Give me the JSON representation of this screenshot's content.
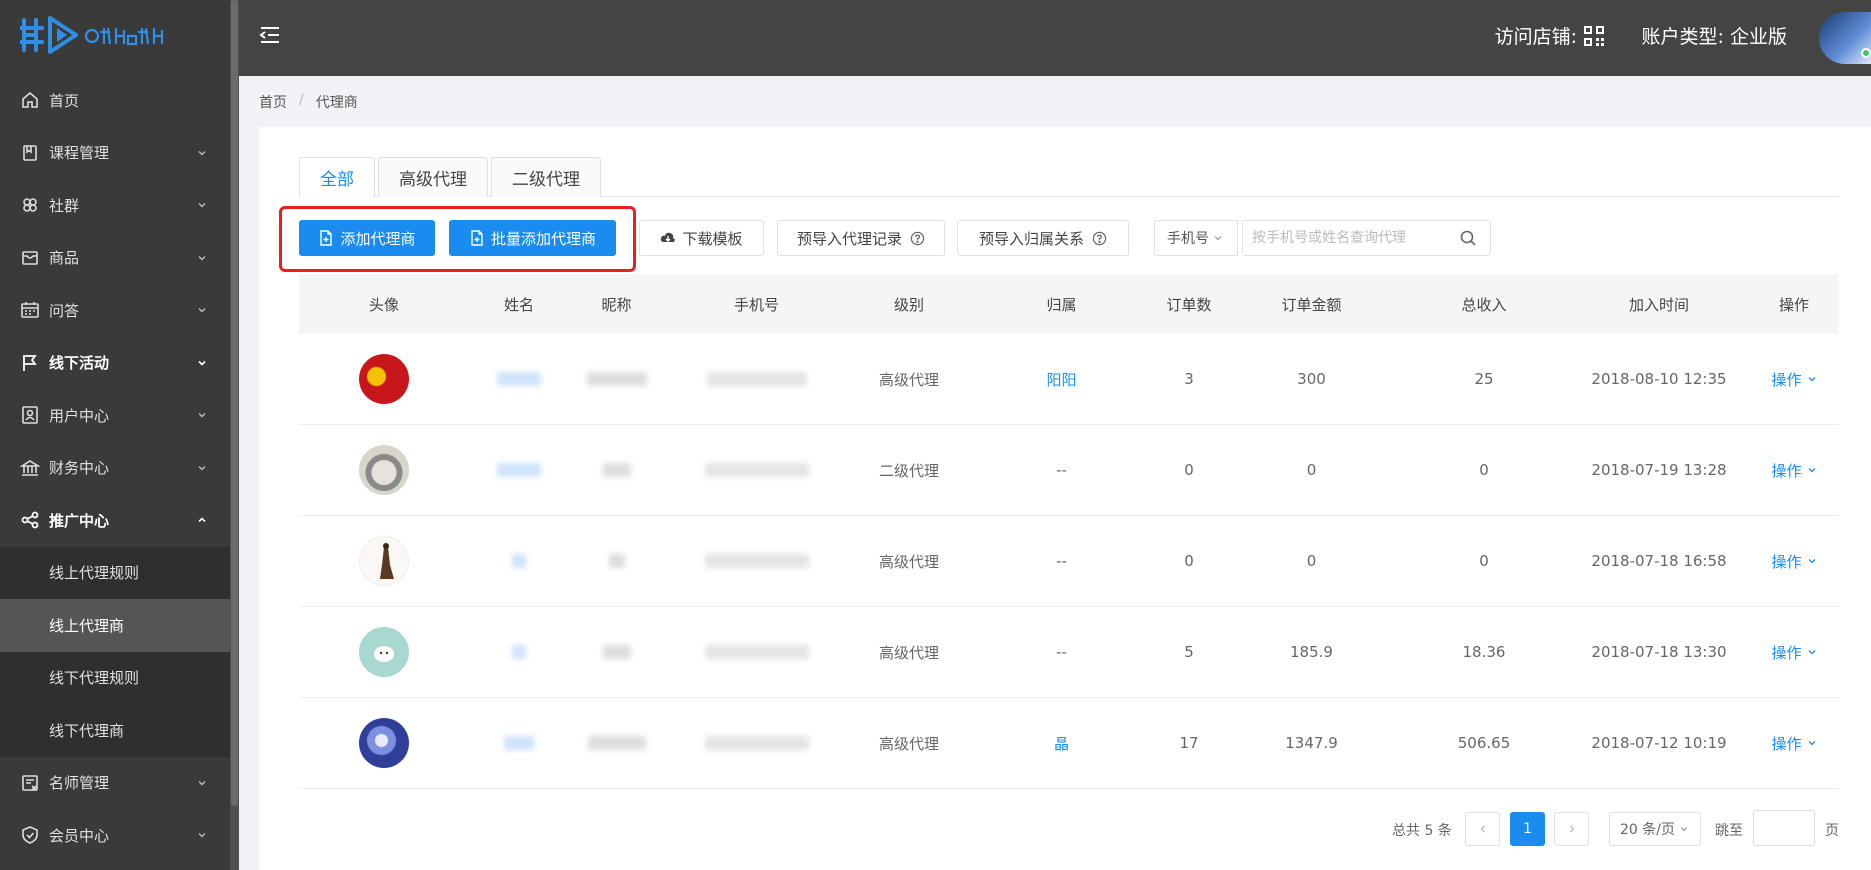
{
  "sidebar": {
    "items": [
      {
        "label": "首页",
        "icon": "home-icon"
      },
      {
        "label": "课程管理",
        "icon": "book-icon"
      },
      {
        "label": "社群",
        "icon": "group-icon"
      },
      {
        "label": "商品",
        "icon": "box-icon"
      },
      {
        "label": "问答",
        "icon": "calendar-icon"
      },
      {
        "label": "线下活动",
        "icon": "flag-icon"
      },
      {
        "label": "用户中心",
        "icon": "user-card-icon"
      },
      {
        "label": "财务中心",
        "icon": "bank-icon"
      },
      {
        "label": "推广中心",
        "icon": "share-icon"
      }
    ],
    "submenu": [
      {
        "label": "线上代理规则"
      },
      {
        "label": "线上代理商"
      },
      {
        "label": "线下代理规则"
      },
      {
        "label": "线下代理商"
      }
    ],
    "items_after": [
      {
        "label": "名师管理",
        "icon": "teacher-icon"
      },
      {
        "label": "会员中心",
        "icon": "shield-icon"
      }
    ]
  },
  "header": {
    "visit_store": "访问店铺:",
    "account_type": "账户类型:  企业版"
  },
  "breadcrumb": {
    "home": "首页",
    "sep": "/",
    "current": "代理商"
  },
  "tabs": [
    "全部",
    "高级代理",
    "二级代理"
  ],
  "toolbar": {
    "add_agent": "添加代理商",
    "batch_add": "批量添加代理商",
    "download_template": "下载模板",
    "pre_import_records": "预导入代理记录",
    "pre_import_relation": "预导入归属关系",
    "phone_select": "手机号",
    "search_placeholder": "按手机号或姓名查询代理"
  },
  "table": {
    "headers": [
      "头像",
      "姓名",
      "昵称",
      "手机号",
      "级别",
      "归属",
      "订单数",
      "订单金额",
      "总收入",
      "加入时间",
      "操作"
    ],
    "rows": [
      {
        "level": "高级代理",
        "belong": "阳阳",
        "belong_link": true,
        "orders": "3",
        "amount": "300",
        "income": "25",
        "time": "2018-08-10 12:35",
        "op": "操作"
      },
      {
        "level": "二级代理",
        "belong": "--",
        "belong_link": false,
        "orders": "0",
        "amount": "0",
        "income": "0",
        "time": "2018-07-19 13:28",
        "op": "操作"
      },
      {
        "level": "高级代理",
        "belong": "--",
        "belong_link": false,
        "orders": "0",
        "amount": "0",
        "income": "0",
        "time": "2018-07-18 16:58",
        "op": "操作"
      },
      {
        "level": "高级代理",
        "belong": "--",
        "belong_link": false,
        "orders": "5",
        "amount": "185.9",
        "income": "18.36",
        "time": "2018-07-18 13:30",
        "op": "操作"
      },
      {
        "level": "高级代理",
        "belong": "晶",
        "belong_link": true,
        "orders": "17",
        "amount": "1347.9",
        "income": "506.65",
        "time": "2018-07-12 10:19",
        "op": "操作"
      }
    ]
  },
  "pagination": {
    "total": "总共 5 条",
    "current_page": "1",
    "page_size": "20 条/页",
    "goto": "跳至",
    "page_suffix": "页"
  },
  "colors": {
    "primary": "#1a8cf0",
    "sidebar": "#3a3a3a",
    "header": "#444444",
    "highlight": "#e62020"
  }
}
